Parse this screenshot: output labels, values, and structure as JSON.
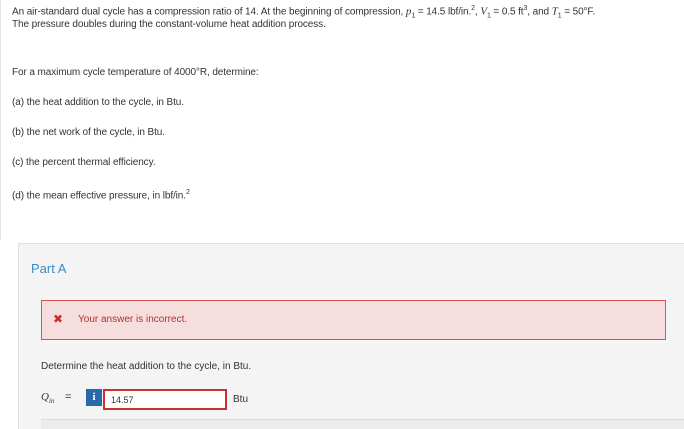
{
  "problem": {
    "intro_prefix": "An air-standard dual cycle has a compression ratio of 14. At the beginning of compression, ",
    "p1_symbol": "p",
    "p1_sub": "1",
    "p1_value": " = 14.5 lbf/in.",
    "p1_sup": "2",
    "v1_symbol": "V",
    "v1_sub": "1",
    "v1_value": " = 0.5 ft",
    "v1_sup": "3",
    "t1_connector": ", and ",
    "t1_symbol": "T",
    "t1_sub": "1",
    "t1_value": " = 50°F.",
    "line2": "The pressure doubles during the constant-volume heat addition process.",
    "for_max": "For a maximum cycle temperature of 4000°R, determine:",
    "item_a": "(a) the heat addition to the cycle, in Btu.",
    "item_b": "(b) the net work of the cycle, in Btu.",
    "item_c": "(c) the percent thermal efficiency.",
    "item_d": "(d) the mean effective pressure, in lbf/in.",
    "item_d_sup": "2"
  },
  "part": {
    "title": "Part A",
    "alert_icon": "✖",
    "alert_text": "Your answer is incorrect.",
    "question": "Determine the heat addition to the cycle, in Btu.",
    "var_symbol": "Q",
    "var_sub": "in",
    "equals": "=",
    "info_label": "i",
    "answer_value": "14.57",
    "unit": "Btu"
  },
  "colors": {
    "part_title": "#3b8bc4",
    "alert_bg": "#f6dede",
    "alert_border": "#d9534f",
    "info_button": "#2a69a9",
    "input_border_error": "#cc2f2f"
  }
}
